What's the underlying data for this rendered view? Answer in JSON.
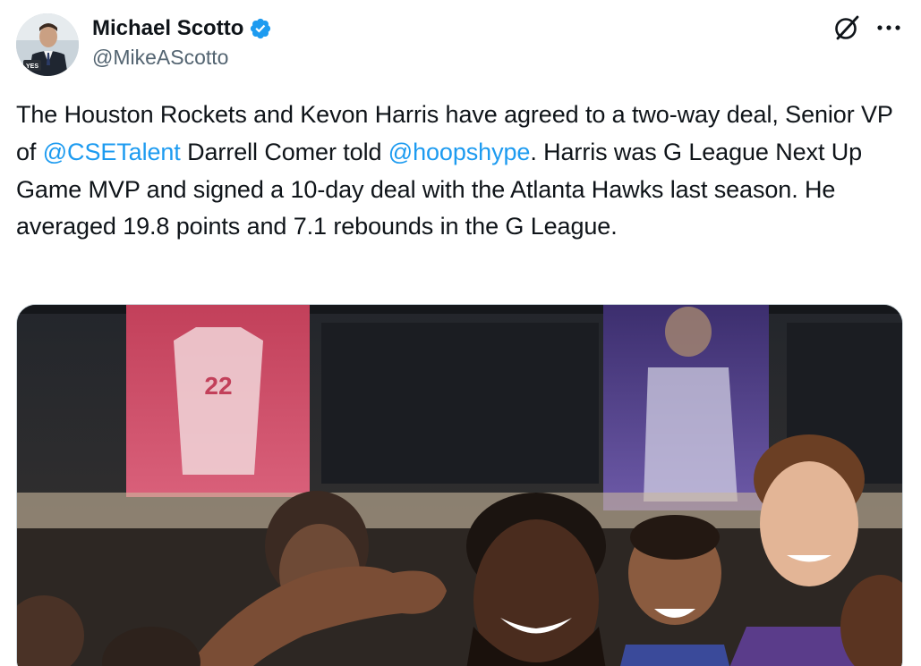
{
  "author": {
    "display_name": "Michael Scotto",
    "handle": "@MikeAScotto",
    "verified": true,
    "verified_color": "#1d9bf0",
    "avatar_badge": "YES"
  },
  "actions": {
    "grok_icon": "grok-icon",
    "more_icon": "more-options-icon"
  },
  "tweet": {
    "segments": [
      {
        "type": "text",
        "value": "The Houston Rockets and Kevon Harris have agreed to a two-way deal, Senior VP of "
      },
      {
        "type": "mention",
        "value": "@CSETalent"
      },
      {
        "type": "text",
        "value": " Darrell Comer told "
      },
      {
        "type": "mention",
        "value": "@hoopshype"
      },
      {
        "type": "text",
        "value": ". Harris was G League Next Up Game MVP and signed a 10-day deal with the Atlanta Hawks last season. He averaged 19.8 points and 7.1 rebounds in the G League."
      }
    ],
    "mention_color": "#1d9bf0"
  },
  "media": {
    "kind": "photo",
    "banner_number": "22"
  }
}
